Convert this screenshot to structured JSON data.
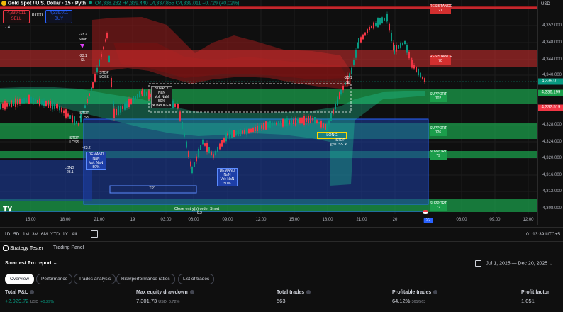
{
  "legend": {
    "symbol": "Gold Spot / U.S. Dollar · 15 · Pyth",
    "open": "O4,338.282",
    "high": "H4,339.440",
    "low": "L4,337.855",
    "close": "C4,339.011",
    "change": "+0.729 (+0.02%)",
    "indicator_count": "4"
  },
  "trade": {
    "sell_price": "4,339.011",
    "sell_label": "SELL",
    "buy_price": "4,339.011",
    "buy_label": "BUY",
    "spread": "0.000"
  },
  "price_axis": {
    "currency": "USD",
    "ticks": [
      "4,352.000",
      "4,348.000",
      "4,344.000",
      "4,340.000",
      "4,328.000",
      "4,324.000",
      "4,320.000",
      "4,316.000",
      "4,312.000",
      "4,308.000"
    ],
    "current": "4,339.011",
    "level_green": "4,336.199",
    "level_red": "4,332.519"
  },
  "time_axis": {
    "ticks": [
      "15:00",
      "18:00",
      "21:00",
      "19",
      "03:00",
      "06:00",
      "09:00",
      "12:00",
      "15:00",
      "18:00",
      "21:00",
      "20",
      "22",
      "06:00",
      "09:00",
      "12:00"
    ],
    "highlight": "22"
  },
  "zones": {
    "resistance_top": {
      "title": "RESISTANCE",
      "value": "21"
    },
    "resistance_mid": {
      "title": "RESISTANCE",
      "value": "70"
    },
    "support_1": {
      "title": "SUPPORT",
      "value": "102"
    },
    "support_2": {
      "title": "SUPPORT",
      "value": "126"
    },
    "support_3": {
      "title": "SUPPORT",
      "value": "79"
    },
    "support_4": {
      "title": "SUPPORT",
      "value": "72"
    }
  },
  "annotations": {
    "short_val": "-23.2",
    "short_lbl": "Short",
    "sl1": "-23.1",
    "sl1_lbl": "SL",
    "stop_loss": "STOP LOSS",
    "stop_loss_x": "STOP LOSS ✕",
    "supply_box": [
      "SUPPLY",
      "NaN",
      "Vol: NaN",
      "50%",
      "✕ BROKEN"
    ],
    "demand_box1": [
      "DEMAND",
      "NaN",
      "Vol: NaN",
      "50%"
    ],
    "demand_box2": [
      "DEMAND",
      "NaN",
      "Vol: NaN",
      "50%"
    ],
    "tp1": "TP1",
    "close_text": "Close entry(s) order Short",
    "close_val": "+9.2",
    "long_lbl": "LONG",
    "long_sl": "-23.1",
    "long_sl_lbl": "SL",
    "val_37": "-37",
    "left_vals": [
      "-23.2",
      "-23.1",
      "SL"
    ],
    "long_left": "LONG",
    "long_left_val": "-23.1"
  },
  "range_bar": {
    "items": [
      "1D",
      "5D",
      "1M",
      "3M",
      "6M",
      "YTD",
      "1Y",
      "All"
    ],
    "clock": "01:13:39 UTC+5"
  },
  "panel_tabs": {
    "strategy": "Strategy Tester",
    "trading": "Trading Panel"
  },
  "report": {
    "title": "Smartest Pro report",
    "date_range": "Jul 1, 2025 — Dec 20, 2025",
    "tabs": [
      "Overview",
      "Performance",
      "Trades analysis",
      "Risk/performance ratios",
      "List of trades"
    ],
    "stats": [
      {
        "label": "Total P&L",
        "value": "+2,929.72",
        "unit": "USD",
        "pct": "+0.29%"
      },
      {
        "label": "Max equity drawdown",
        "value": "7,301.73",
        "unit": "USD",
        "pct": "0.72%"
      },
      {
        "label": "Total trades",
        "value": "563",
        "unit": "",
        "pct": ""
      },
      {
        "label": "Profitable trades",
        "value": "64.12%",
        "unit": "361/563",
        "pct": ""
      },
      {
        "label": "Profit factor",
        "value": "1.051",
        "unit": "",
        "pct": ""
      }
    ]
  },
  "colors": {
    "up": "#089981",
    "down": "#f23645",
    "resistance": "#b71c1c",
    "support": "#1b9e4b",
    "demand": "#1e3fa8",
    "accent": "#2962ff"
  }
}
